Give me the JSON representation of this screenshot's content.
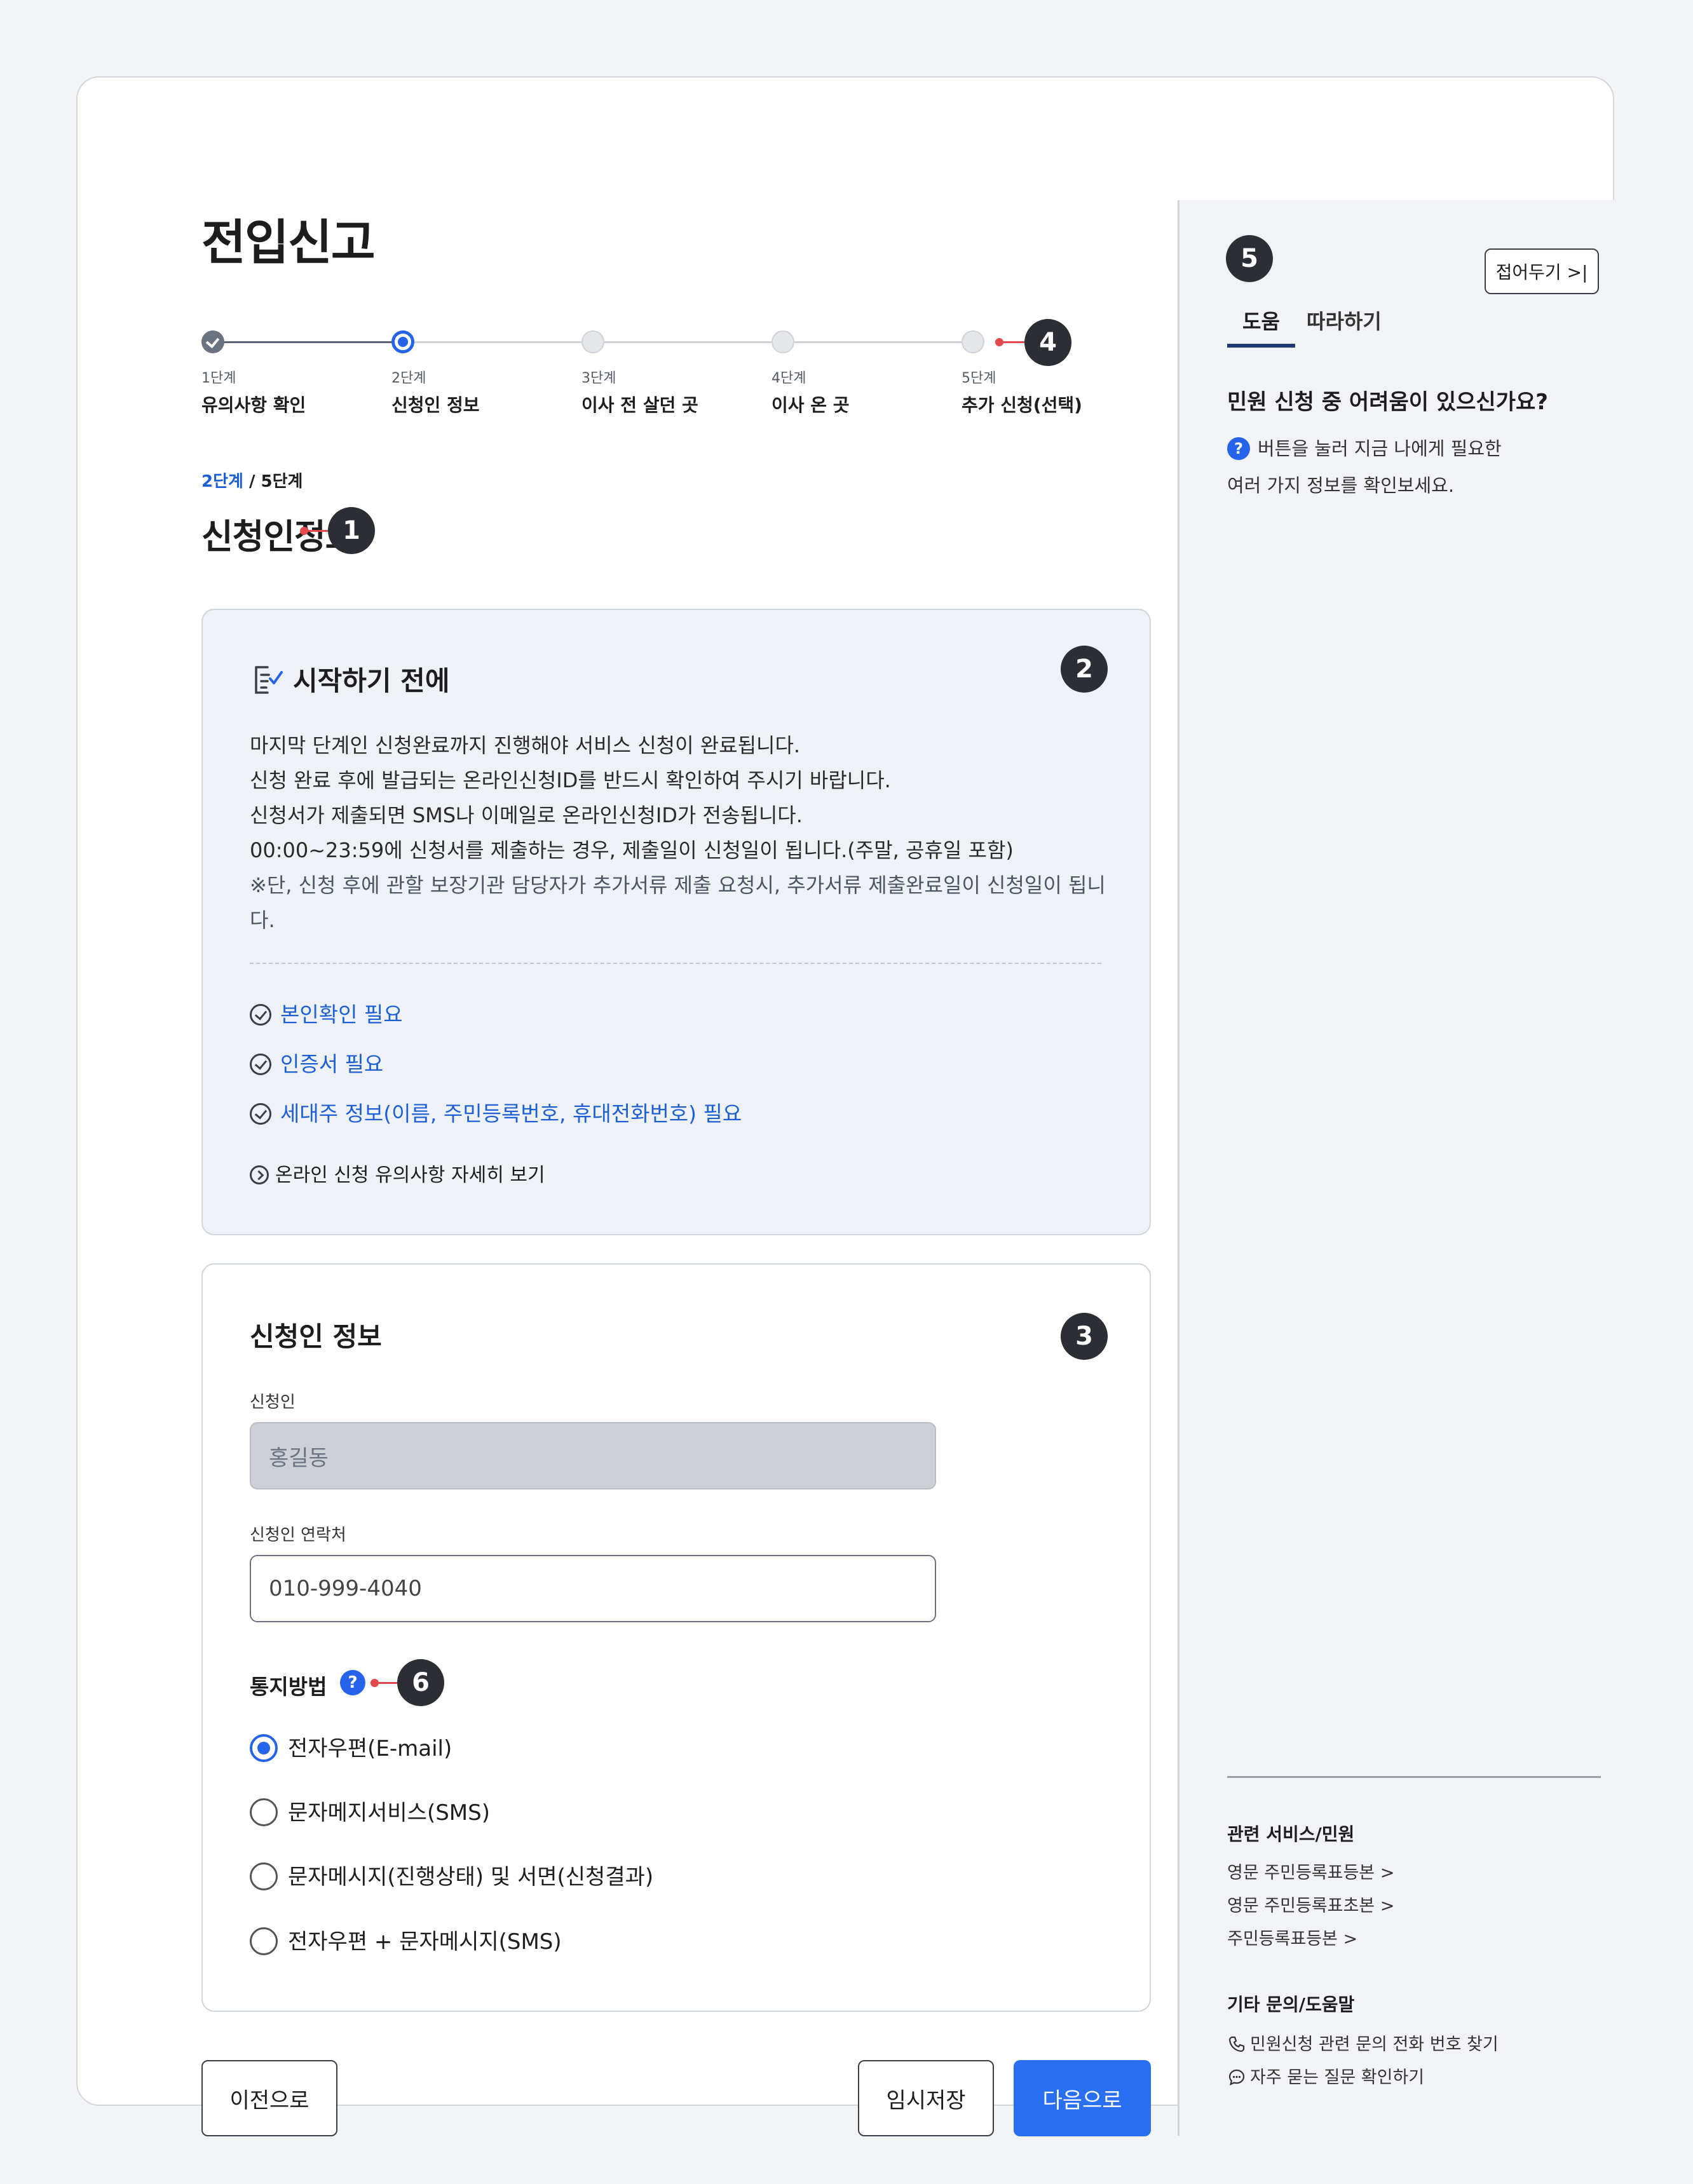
{
  "page": {
    "title": "전입신고"
  },
  "stepper": {
    "steps": [
      {
        "num": "1단계",
        "name": "유의사항 확인",
        "state": "done"
      },
      {
        "num": "2단계",
        "name": "신청인 정보",
        "state": "current"
      },
      {
        "num": "3단계",
        "name": "이사 전 살던 곳",
        "state": "todo"
      },
      {
        "num": "4단계",
        "name": "이사 온 곳",
        "state": "todo"
      },
      {
        "num": "5단계",
        "name": "추가 신청(선택)",
        "state": "todo"
      }
    ]
  },
  "stage": {
    "current": "2단계",
    "separator": " / ",
    "total": "5단계"
  },
  "section": {
    "title": "신청인정보"
  },
  "annotations": [
    "1",
    "2",
    "3",
    "4",
    "5",
    "6"
  ],
  "notice": {
    "title": "시작하기 전에",
    "lines": [
      "마지막 단계인 신청완료까지 진행해야 서비스 신청이 완료됩니다.",
      "신청 완료 후에 발급되는 온라인신청ID를 반드시 확인하여 주시기 바랍니다.",
      "신청서가 제출되면 SMS나 이메일로 온라인신청ID가 전송됩니다.",
      "00:00~23:59에 신청서를 제출하는 경우, 제출일이 신청일이 됩니다.(주말, 공휴일 포함)"
    ],
    "footnote": "※단, 신청 후에 관할 보장기관 담당자가 추가서류 제출 요청시, 추가서류 제출완료일이 신청일이 됩니다.",
    "requirements": [
      "본인확인 필요",
      "인증서 필요",
      "세대주 정보(이름, 주민등록번호, 휴대전화번호) 필요"
    ],
    "more_link": "온라인 신청 유의사항 자세히 보기"
  },
  "form": {
    "title": "신청인 정보",
    "applicant": {
      "label": "신청인",
      "value": "홍길동"
    },
    "contact": {
      "label": "신청인 연락처",
      "value": "010-999-4040"
    },
    "notify": {
      "label": "통지방법",
      "help_icon": "?",
      "options": [
        "전자우편(E-mail)",
        "문자메지서비스(SMS)",
        "문자메시지(진행상태) 및 서면(신청결과)",
        "전자우편 + 문자메시지(SMS)"
      ],
      "selected_index": 0
    }
  },
  "buttons": {
    "prev": "이전으로",
    "save": "임시저장",
    "next": "다음으로"
  },
  "side": {
    "collapse": "접어두기 >|",
    "tabs": [
      "도움",
      "따라하기"
    ],
    "question": "민원 신청 중 어려움이 있으신가요?",
    "help_icon": "?",
    "desc_line1": "버튼을 눌러 지금 나에게 필요한",
    "desc_line2": "여러 가지 정보를 확인보세요.",
    "related_title": "관련 서비스/민원",
    "related_links": [
      "영문 주민등록표등본 >",
      "영문 주민등록표초본 >",
      "주민등록표등본 >"
    ],
    "etc_title": "기타 문의/도움말",
    "etc_links": [
      "민원신청 관련 문의 전화 번호 찾기",
      "자주 묻는 질문 확인하기"
    ]
  },
  "colors": {
    "accent": "#2563eb",
    "primary_button": "#2a6ff2",
    "annotation_badge": "#2b2e34",
    "pin": "#e5484d"
  },
  "icons": {
    "checklist": "checklist-icon",
    "check_circle": "check-circle-icon",
    "chevron_circle": "chevron-right-circle-icon",
    "phone": "phone-icon",
    "chat": "chat-icon",
    "help": "question-circle-icon"
  }
}
